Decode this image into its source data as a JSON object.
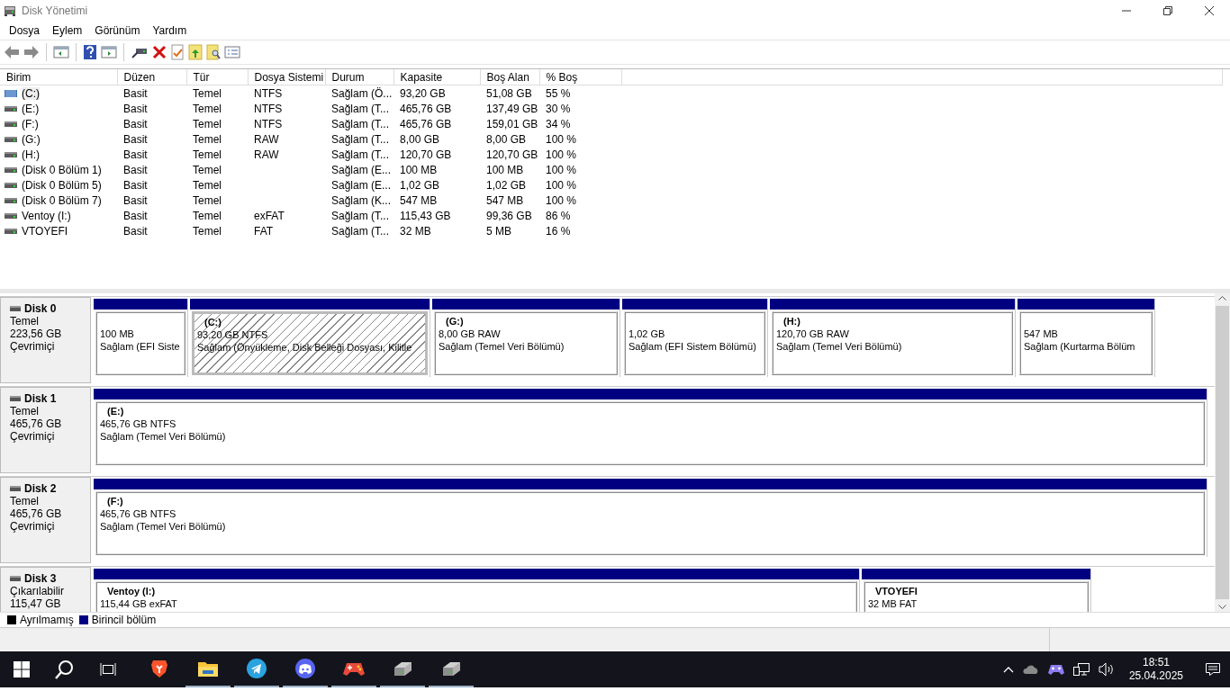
{
  "window": {
    "title": "Disk Yönetimi"
  },
  "menu": [
    "Dosya",
    "Eylem",
    "Görünüm",
    "Yardım"
  ],
  "volumes": {
    "columns": [
      "Birim",
      "Düzen",
      "Tür",
      "Dosya Sistemi",
      "Durum",
      "Kapasite",
      "Boş Alan",
      "% Boş"
    ],
    "rows": [
      {
        "kind": "system",
        "selected": true,
        "cells": [
          "(C:)",
          "Basit",
          "Temel",
          "NTFS",
          "Sağlam (Ö...",
          "93,20 GB",
          "51,08 GB",
          "55 %"
        ]
      },
      {
        "kind": "drive",
        "selected": false,
        "cells": [
          "(E:)",
          "Basit",
          "Temel",
          "NTFS",
          "Sağlam (T...",
          "465,76 GB",
          "137,49 GB",
          "30 %"
        ]
      },
      {
        "kind": "drive",
        "selected": false,
        "cells": [
          "(F:)",
          "Basit",
          "Temel",
          "NTFS",
          "Sağlam (T...",
          "465,76 GB",
          "159,01 GB",
          "34 %"
        ]
      },
      {
        "kind": "drive",
        "selected": false,
        "cells": [
          "(G:)",
          "Basit",
          "Temel",
          "RAW",
          "Sağlam (T...",
          "8,00 GB",
          "8,00 GB",
          "100 %"
        ]
      },
      {
        "kind": "drive",
        "selected": false,
        "cells": [
          "(H:)",
          "Basit",
          "Temel",
          "RAW",
          "Sağlam (T...",
          "120,70 GB",
          "120,70 GB",
          "100 %"
        ]
      },
      {
        "kind": "drive",
        "selected": false,
        "cells": [
          "(Disk 0 Bölüm 1)",
          "Basit",
          "Temel",
          "",
          "Sağlam (E...",
          "100 MB",
          "100 MB",
          "100 %"
        ]
      },
      {
        "kind": "drive",
        "selected": false,
        "cells": [
          "(Disk 0 Bölüm 5)",
          "Basit",
          "Temel",
          "",
          "Sağlam (E...",
          "1,02 GB",
          "1,02 GB",
          "100 %"
        ]
      },
      {
        "kind": "drive",
        "selected": false,
        "cells": [
          "(Disk 0 Bölüm 7)",
          "Basit",
          "Temel",
          "",
          "Sağlam (K...",
          "547 MB",
          "547 MB",
          "100 %"
        ]
      },
      {
        "kind": "drive",
        "selected": false,
        "cells": [
          "Ventoy (I:)",
          "Basit",
          "Temel",
          "exFAT",
          "Sağlam (T...",
          "115,43 GB",
          "99,36 GB",
          "86 %"
        ]
      },
      {
        "kind": "drive",
        "selected": false,
        "cells": [
          "VTOYEFI",
          "Basit",
          "Temel",
          "FAT",
          "Sağlam (T...",
          "32 MB",
          "5 MB",
          "16 %"
        ]
      }
    ]
  },
  "disks": [
    {
      "name": "Disk 0",
      "type": "Temel",
      "size": "223,56 GB",
      "status": "Çevrimiçi",
      "partitions": [
        {
          "selected": false,
          "size": "100 MB",
          "state": "Sağlam (EFI Siste"
        },
        {
          "selected": true,
          "label": "(C:)",
          "size": "93,20 GB NTFS",
          "state": "Sağlam (Önyükleme, Disk Belleği Dosyası, Kilitle"
        },
        {
          "selected": false,
          "label": "(G:)",
          "size": "8,00 GB RAW",
          "state": "Sağlam (Temel Veri Bölümü)"
        },
        {
          "selected": false,
          "size": "1,02 GB",
          "state": "Sağlam (EFI Sistem Bölümü)"
        },
        {
          "selected": false,
          "label": "(H:)",
          "size": "120,70 GB RAW",
          "state": "Sağlam (Temel Veri Bölümü)"
        },
        {
          "selected": false,
          "size": "547 MB",
          "state": "Sağlam (Kurtarma Bölüm"
        }
      ]
    },
    {
      "name": "Disk 1",
      "type": "Temel",
      "size": "465,76 GB",
      "status": "Çevrimiçi",
      "partitions": [
        {
          "selected": false,
          "label": "(E:)",
          "size": "465,76 GB NTFS",
          "state": "Sağlam (Temel Veri Bölümü)"
        }
      ]
    },
    {
      "name": "Disk 2",
      "type": "Temel",
      "size": "465,76 GB",
      "status": "Çevrimiçi",
      "partitions": [
        {
          "selected": false,
          "label": "(F:)",
          "size": "465,76 GB NTFS",
          "state": "Sağlam (Temel Veri Bölümü)"
        }
      ]
    },
    {
      "name": "Disk 3",
      "type": "Çıkarılabilir",
      "size": "115,47 GB",
      "partitions": [
        {
          "selected": false,
          "label": "Ventoy  (I:)",
          "size": "115,44 GB exFAT"
        },
        {
          "selected": false,
          "label": "VTOYEFI",
          "size": "32 MB FAT"
        }
      ]
    }
  ],
  "legend": [
    {
      "label": "Ayrılmamış",
      "color": "#000000"
    },
    {
      "label": "Birincil bölüm",
      "color": "#000080"
    }
  ],
  "taskbar": {
    "apps": [
      {
        "kind": "brave",
        "running": false
      },
      {
        "kind": "files",
        "running": true
      },
      {
        "kind": "telegram",
        "running": true
      },
      {
        "kind": "discord",
        "running": true
      },
      {
        "kind": "game",
        "running": true
      },
      {
        "kind": "disk",
        "running": true
      },
      {
        "kind": "disk",
        "running": true
      }
    ],
    "time": "18:51",
    "date": "25.04.2025"
  }
}
